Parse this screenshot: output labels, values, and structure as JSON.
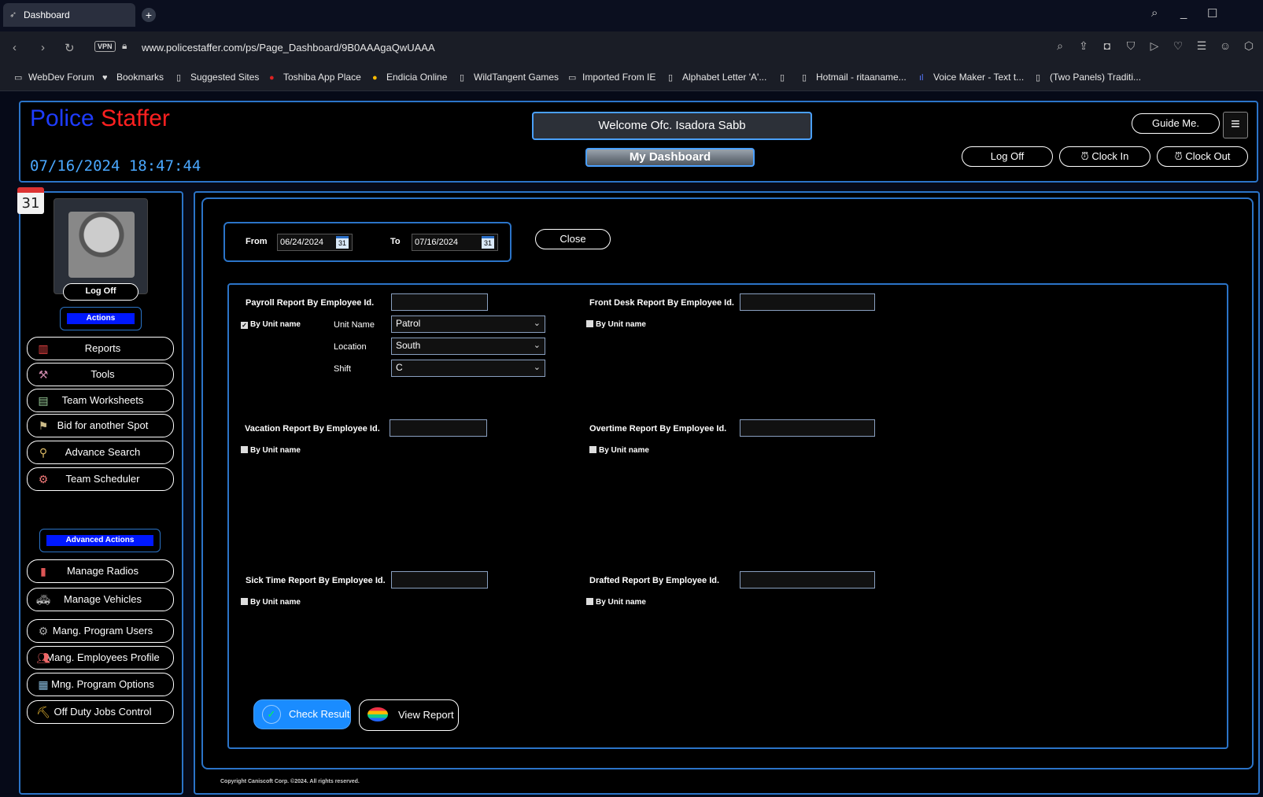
{
  "browser": {
    "tab_title": "Dashboard",
    "url": "www.policestaffer.com/ps/Page_Dashboard/9B0AAAgaQwUAAA",
    "vpn_label": "VPN",
    "bookmarks": [
      "WebDev Forum",
      "Bookmarks",
      "Suggested Sites",
      "Toshiba App Place",
      "Endicia Online",
      "WildTangent Games",
      "Imported From IE",
      "Alphabet Letter 'A'...",
      "Hotmail - ritaaname...",
      "Voice Maker - Text t...",
      "(Two Panels) Traditi..."
    ]
  },
  "header": {
    "logo_part1": "Police",
    "logo_part2": "Staffer",
    "datetime": "07/16/2024 18:47:44",
    "welcome": "Welcome Ofc. Isadora Sabb",
    "dashboard_button": "My Dashboard",
    "guide_button": "Guide Me.",
    "logoff_button": "Log Off",
    "clockin_button": "Clock In",
    "clockout_button": "Clock Out"
  },
  "sidebar": {
    "calendar_day": "31",
    "logoff": "Log Off",
    "actions_label": "Actions",
    "items": [
      {
        "label": "Reports",
        "icon": "bar-chart-icon"
      },
      {
        "label": "Tools",
        "icon": "tools-icon"
      },
      {
        "label": "Team Worksheets",
        "icon": "worksheet-icon"
      },
      {
        "label": "Bid for another Spot",
        "icon": "bid-icon"
      },
      {
        "label": "Advance Search",
        "icon": "search-icon"
      },
      {
        "label": "Team Scheduler",
        "icon": "scheduler-icon"
      }
    ],
    "advanced_label": "Advanced Actions",
    "advanced_items": [
      {
        "label": "Manage Radios",
        "icon": "radio-icon"
      },
      {
        "label": "Manage Vehicles",
        "icon": "vehicle-icon"
      },
      {
        "label": "Mang. Program Users",
        "icon": "users-icon"
      },
      {
        "label": "Mang. Employees Profile",
        "icon": "employees-icon"
      },
      {
        "label": "Mng. Program Options",
        "icon": "options-icon"
      },
      {
        "label": "Off Duty Jobs Control",
        "icon": "jobs-icon"
      }
    ]
  },
  "dates": {
    "from_label": "From",
    "from_value": "06/24/2024",
    "to_label": "To",
    "to_value": "07/16/2024",
    "calendar_glyph": "31",
    "close_button": "Close"
  },
  "reports": {
    "payroll_label": "Payroll Report By Employee Id.",
    "payroll_by_unit": "By Unit name",
    "payroll_by_unit_checked": true,
    "unit_name_label": "Unit Name",
    "unit_name_value": "Patrol",
    "location_label": "Location",
    "location_value": "South",
    "shift_label": "Shift",
    "shift_value": "C",
    "frontdesk_label": "Front Desk Report By Employee Id.",
    "frontdesk_by_unit": "By Unit name",
    "vacation_label": "Vacation Report By Employee Id.",
    "vacation_by_unit": "By Unit name",
    "overtime_label": "Overtime Report By Employee Id.",
    "overtime_by_unit": "By Unit name",
    "sick_label": "Sick Time Report By Employee Id.",
    "sick_by_unit": "By Unit name",
    "drafted_label": "Drafted Report By Employee Id.",
    "drafted_by_unit": "By Unit name",
    "check_result_button": "Check Result",
    "view_report_button": "View Report"
  },
  "footer": {
    "copyright": "Copyright Caniscoft Corp. ©2024. All rights reserved."
  },
  "colors": {
    "accent_border": "#2b74c8",
    "logo_blue": "#1e3cff",
    "logo_red": "#ff2020",
    "clock_blue": "#4aa8ff",
    "check_result_bg": "#1a8cff"
  }
}
